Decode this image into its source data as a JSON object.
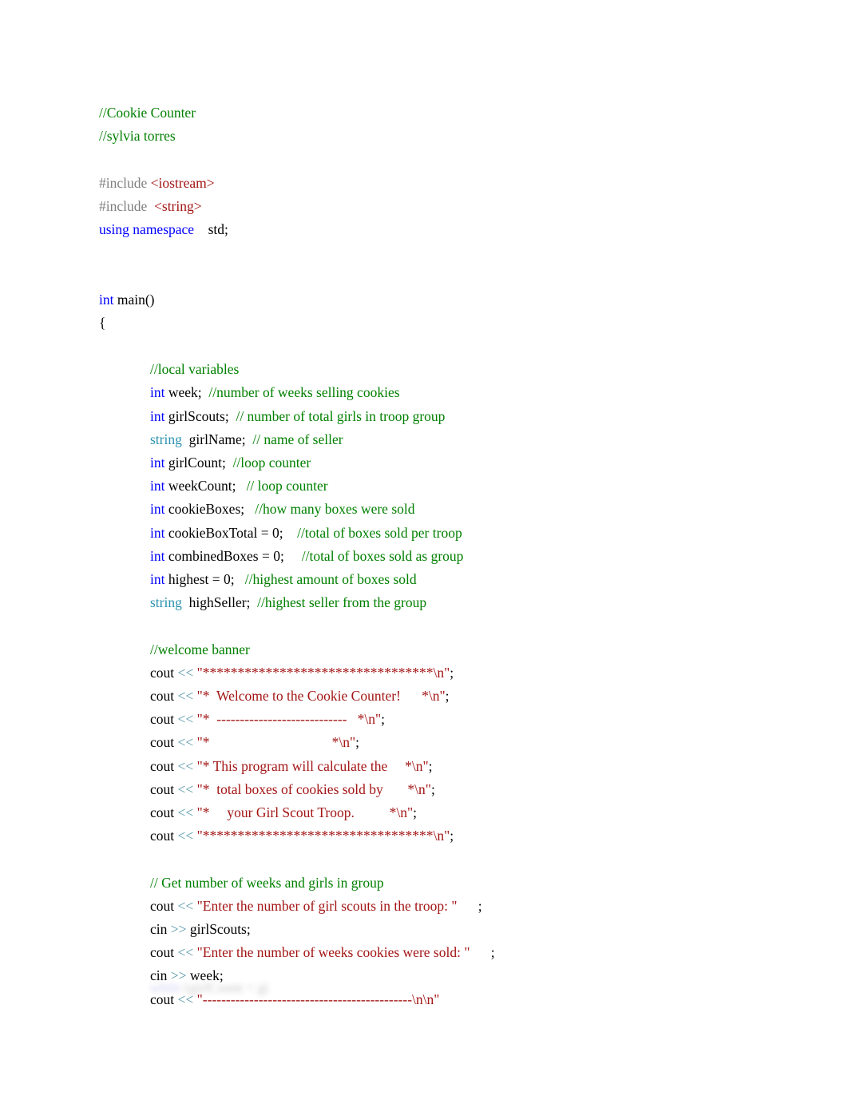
{
  "document": {
    "kind": "source-code-listing",
    "language": "C++",
    "background_color": "#ffffff",
    "title_comment": "//Cookie Counter",
    "author_comment": "//sylvia torres"
  },
  "colors": {
    "keyword": "#0000ff",
    "type": "#2b91af",
    "preprocessor": "#808080",
    "string": "#a31515",
    "comment": "#008000",
    "operator": "#5a9aa8",
    "plain": "#000000"
  },
  "code": {
    "header": {
      "comment_title": "//Cookie Counter",
      "comment_author": "//sylvia torres",
      "include_keyword_1": "#include ",
      "include_header_1": "<iostream>",
      "include_keyword_2": "#include  ",
      "include_header_2": "<string>",
      "using_keyword": "using namespace",
      "using_value": "    std;"
    },
    "main": {
      "return_type": "int",
      "signature": " main()",
      "open_brace": "{"
    },
    "locals": {
      "section_comment": "//local variables",
      "declarations": [
        {
          "kw": "int",
          "name": " week;  ",
          "comment": "//number of weeks selling cookies"
        },
        {
          "kw": "int",
          "name": " girlScouts;  ",
          "comment": "// number of total girls in troop group"
        },
        {
          "kw": "string",
          "name": "  girlName;  ",
          "comment": "// name of seller"
        },
        {
          "kw": "int",
          "name": " girlCount;  ",
          "comment": "//loop counter"
        },
        {
          "kw": "int",
          "name": " weekCount;   ",
          "comment": "// loop counter"
        },
        {
          "kw": "int",
          "name": " cookieBoxes;   ",
          "comment": "//how many boxes were sold"
        },
        {
          "kw": "int",
          "name": " cookieBoxTotal = 0;    ",
          "comment": "//total of boxes sold per troop"
        },
        {
          "kw": "int",
          "name": " combinedBoxes = 0;     ",
          "comment": "//total of boxes sold as group"
        },
        {
          "kw": "int",
          "name": " highest = 0;   ",
          "comment": "//highest amount of boxes sold"
        },
        {
          "kw": "string",
          "name": "  highSeller;  ",
          "comment": "//highest seller from the group"
        }
      ]
    },
    "banner": {
      "section_comment": "//welcome banner",
      "stream_name": "cout ",
      "operator": "<< ",
      "lines": [
        {
          "text": "\"*********************************\\n\"",
          "suffix": ";"
        },
        {
          "text": "\"*  Welcome to the Cookie Counter!      *\\n\"",
          "suffix": ";"
        },
        {
          "text": "\"*  ----------------------------   *\\n\"",
          "suffix": ";"
        },
        {
          "text": "\"*                                   *\\n\"",
          "suffix": ";"
        },
        {
          "text": "\"* This program will calculate the     *\\n\"",
          "suffix": ";"
        },
        {
          "text": "\"*  total boxes of cookies sold by       *\\n\"",
          "suffix": ";"
        },
        {
          "text": "\"*     your Girl Scout Troop.          *\\n\"",
          "suffix": ";"
        },
        {
          "text": "\"*********************************\\n\"",
          "suffix": ";"
        }
      ]
    },
    "input": {
      "section_comment": "// Get number of weeks and girls in group",
      "cout_name": "cout ",
      "cin_name": "cin ",
      "out_operator": "<< ",
      "in_operator": ">> ",
      "prompt_girl_scouts": "\"Enter the number of girl scouts in the troop: \"",
      "prompt_girl_scouts_suffix": "      ;",
      "read_girl_scouts": "girlScouts;",
      "prompt_weeks": "\"Enter the number of weeks cookies were sold: \"",
      "prompt_weeks_suffix": "      ;",
      "read_weeks": "week;",
      "divider_line": "\"---------------------------------------------\\n\\n\""
    },
    "faded_trailing": {
      "keyword": "while",
      "rest": " (girlCount < gi"
    }
  }
}
